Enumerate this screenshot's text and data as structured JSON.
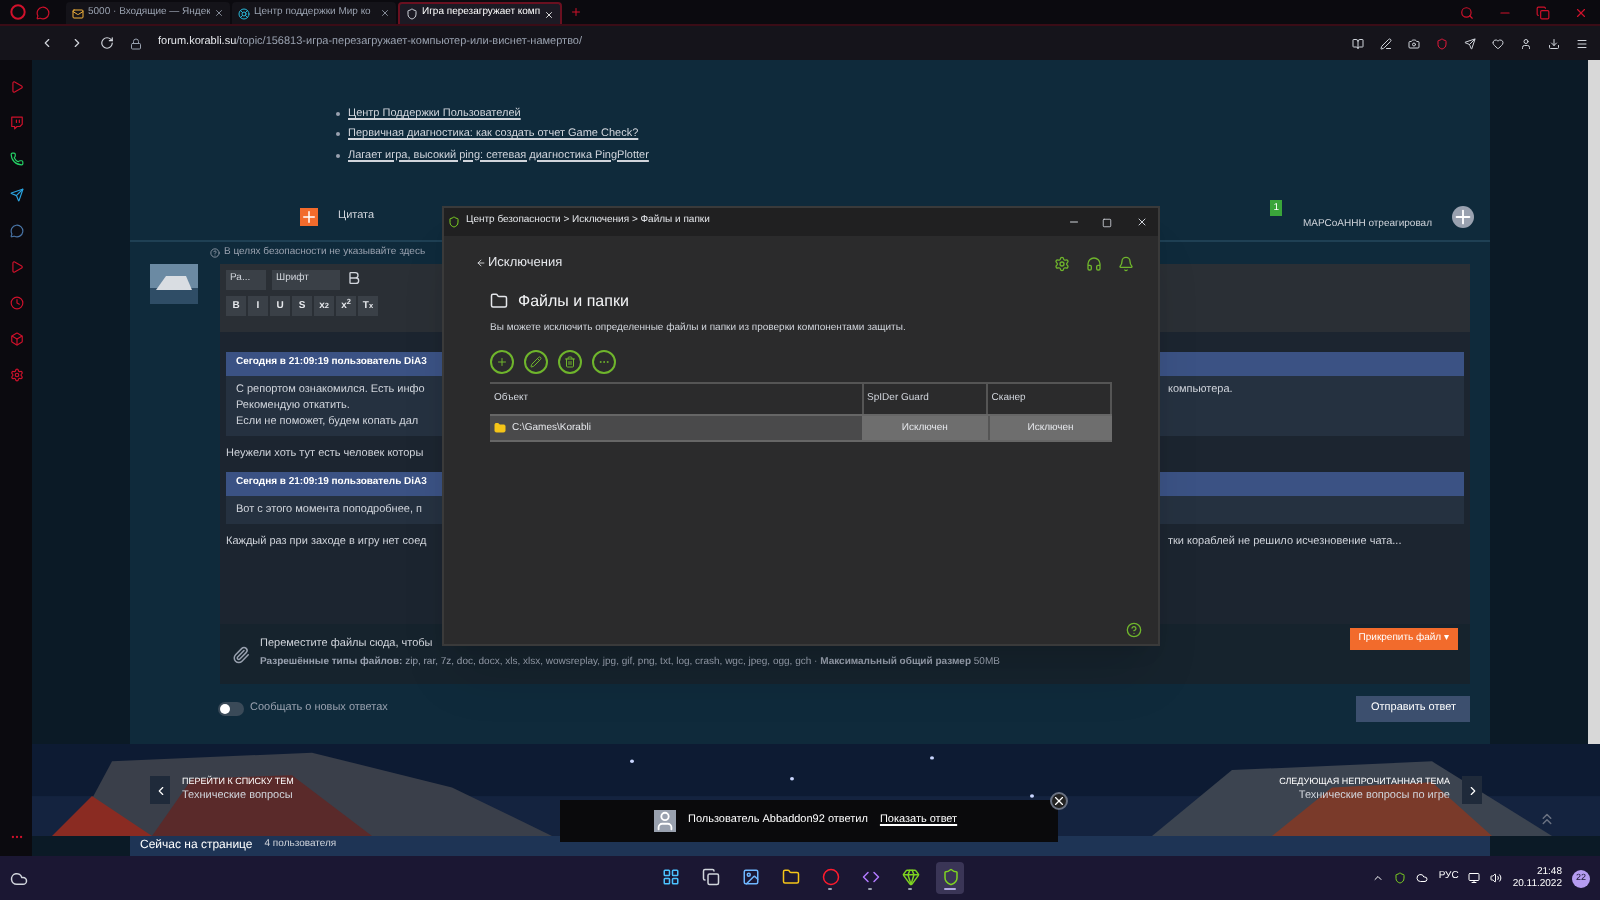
{
  "browser": {
    "tabs": [
      {
        "title": "5000 · Входящие — Яндек",
        "kind": "mail",
        "selected": false
      },
      {
        "title": "Центр поддержки Мир ко",
        "kind": "support",
        "selected": false
      },
      {
        "title": "Игра перезагружает комп",
        "kind": "forum",
        "selected": true
      }
    ],
    "url_host": "forum.korabli.su",
    "url_path": "/topic/156813-игра-перезагружает-компьютер-или-виснет-намертво/"
  },
  "post": {
    "links": [
      "Центр Поддержки Пользователей",
      "Первичная диагностика: как создать отчет Game Check?",
      "Лагает игра, высокий ping: сетевая диагностика PingPlotter"
    ],
    "quote_label": "Цитата",
    "reaction": "МАРСоАННН отреагировал",
    "reaction_count": "1"
  },
  "security_note": "В целях безопасности не указывайте здесь",
  "editor": {
    "selects": [
      "Ра...",
      "Шрифт"
    ],
    "format_buttons": [
      "B",
      "I",
      "U",
      "S",
      "x$_{2}$",
      "x$^{2}$",
      "T$_{x}$"
    ],
    "body": [
      {
        "kind": "quote",
        "header": "Сегодня в 21:09:19 пользователь DiA3",
        "lines": [
          {
            "left": "С репортом ознакомился. Есть инфо",
            "right": "компьютера."
          },
          {
            "left": "Рекомендую откатить."
          },
          {
            "left": "Если не поможет, будем копать дал"
          }
        ]
      },
      {
        "kind": "text",
        "left": "Неужели хоть тут есть человек которы"
      },
      {
        "kind": "quote",
        "header": "Сегодня в 21:09:19 пользователь DiA3",
        "lines": [
          {
            "left": "Вот с этого момента поподробнее, п"
          }
        ]
      },
      {
        "kind": "text",
        "left": "Каждый раз при заходе в игру нет соед",
        "right": "тки кораблей не решило исчезновение чата..."
      }
    ]
  },
  "attach": {
    "hint": "Переместите файлы сюда, чтобы",
    "types": "**Разрешённые типы файлов:** zip, rar, 7z, doc, docx, xls, xlsx, wowsreplay, jpg, gif, png, txt, log, crash, wgc, jpeg, ogg, gch · **Максимальный общий размер** 50MB",
    "button": "Прикрепить файл ▾"
  },
  "notify": {
    "label": "Сообщать о новых ответах",
    "on": false
  },
  "submit": "Отправить ответ",
  "topic_nav": {
    "prev": {
      "label": "ПЕРЕЙТИ К СПИСКУ ТЕМ",
      "title": "Технические вопросы"
    },
    "next": {
      "label": "СЛЕДУЮЩАЯ НЕПРОЧИТАННАЯ ТЕМА",
      "title": "Технические вопросы по игре"
    }
  },
  "online": {
    "label": "Сейчас на странице",
    "count": "4 пользователя"
  },
  "dialog": {
    "title": "Центр безопасности > Исключения > Файлы и папки",
    "back": "Исключения",
    "heading": "Файлы и папки",
    "description": "Вы можете исключить определенные файлы и папки из проверки компонентами защиты.",
    "columns": [
      "Объект",
      "SpIDer Guard",
      "Сканер"
    ],
    "rows": [
      {
        "object": "C:\\Games\\Korabli",
        "guard": "Исключен",
        "scanner": "Исключен",
        "selected": true
      }
    ]
  },
  "toast": {
    "message": "Пользователь Abbaddon92 ответил",
    "link": "Показать ответ"
  },
  "taskbar": {
    "apps": [
      {
        "kind": "start",
        "running": false,
        "selected": false
      },
      {
        "kind": "views",
        "running": false,
        "selected": false
      },
      {
        "kind": "photos",
        "running": false,
        "selected": false
      },
      {
        "kind": "folder",
        "running": false,
        "selected": false
      },
      {
        "kind": "browser",
        "running": true,
        "selected": false
      },
      {
        "kind": "studio",
        "running": true,
        "selected": false
      },
      {
        "kind": "gem",
        "running": true,
        "selected": false
      },
      {
        "kind": "shield",
        "running": true,
        "selected": true
      }
    ],
    "language": "РУС",
    "time": "21:48",
    "date": "20.11.2022",
    "badge": "22"
  }
}
